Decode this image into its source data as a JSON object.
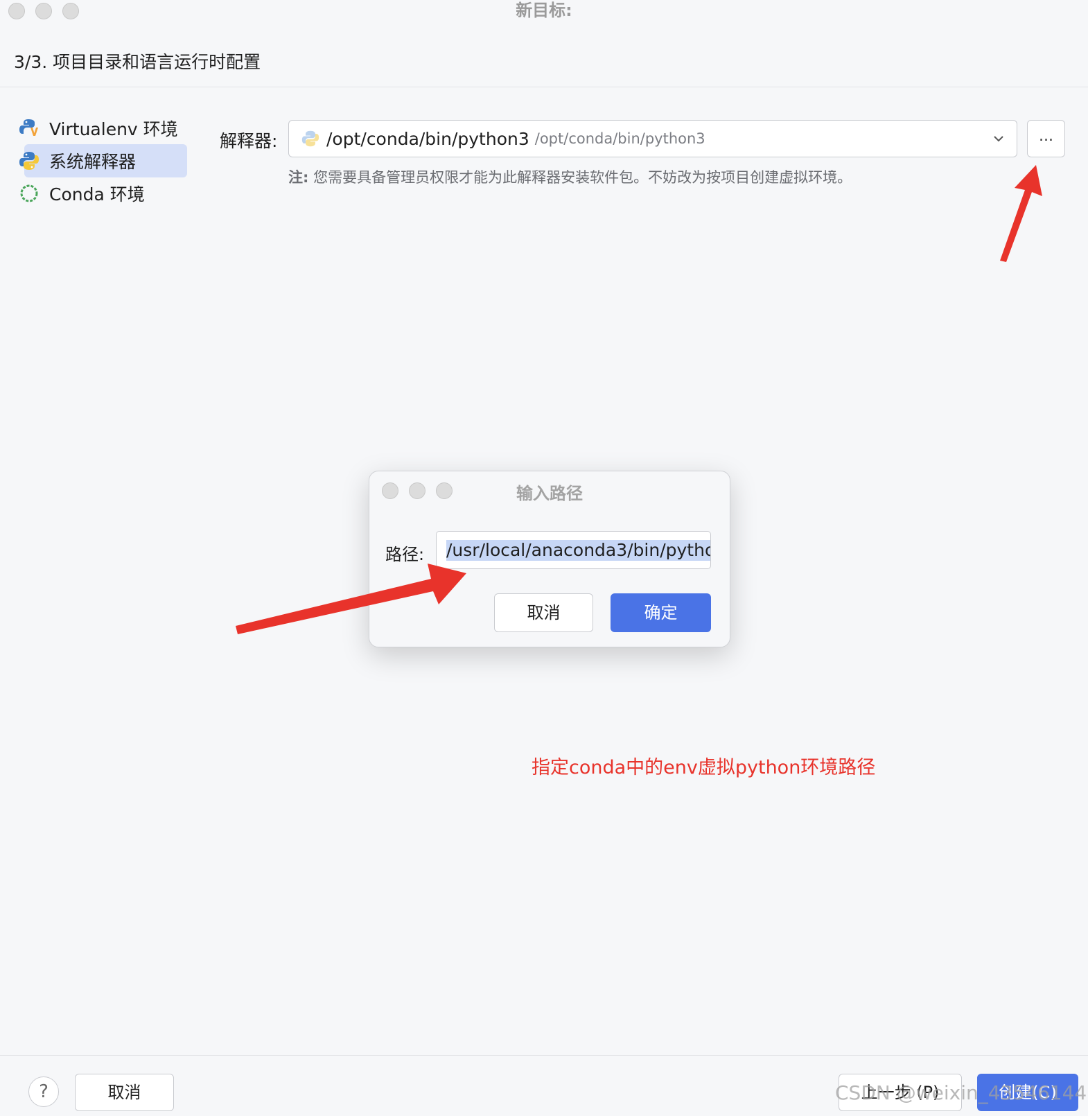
{
  "window": {
    "title": "新目标:"
  },
  "step_title": "3/3. 项目目录和语言运行时配置",
  "sidebar": {
    "items": [
      {
        "label": "Virtualenv 环境",
        "icon": "python-virtualenv-icon"
      },
      {
        "label": "系统解释器",
        "icon": "python-icon",
        "selected": true
      },
      {
        "label": "Conda 环境",
        "icon": "conda-icon"
      }
    ]
  },
  "interpreter": {
    "label": "解释器:",
    "selected_main": "/opt/conda/bin/python3",
    "selected_sub": "/opt/conda/bin/python3",
    "more_label": "...",
    "note_prefix": "注:",
    "note_text": " 您需要具备管理员权限才能为此解释器安装软件包。不妨改为按项目创建虚拟环境。"
  },
  "dialog": {
    "title": "输入路径",
    "path_label": "路径:",
    "path_value": "/usr/local/anaconda3/bin/pytho",
    "cancel_label": "取消",
    "ok_label": "确定"
  },
  "annotation": "指定conda中的env虚拟python环境路径",
  "footer": {
    "help_label": "?",
    "cancel_label": "取消",
    "prev_label": "上一步 (P)",
    "create_label": "创建(C)"
  },
  "watermark": "CSDN @weixin_43546144",
  "colors": {
    "accent": "#4a73e6",
    "annotation": "#e8332b",
    "selection": "#d5dff8"
  }
}
